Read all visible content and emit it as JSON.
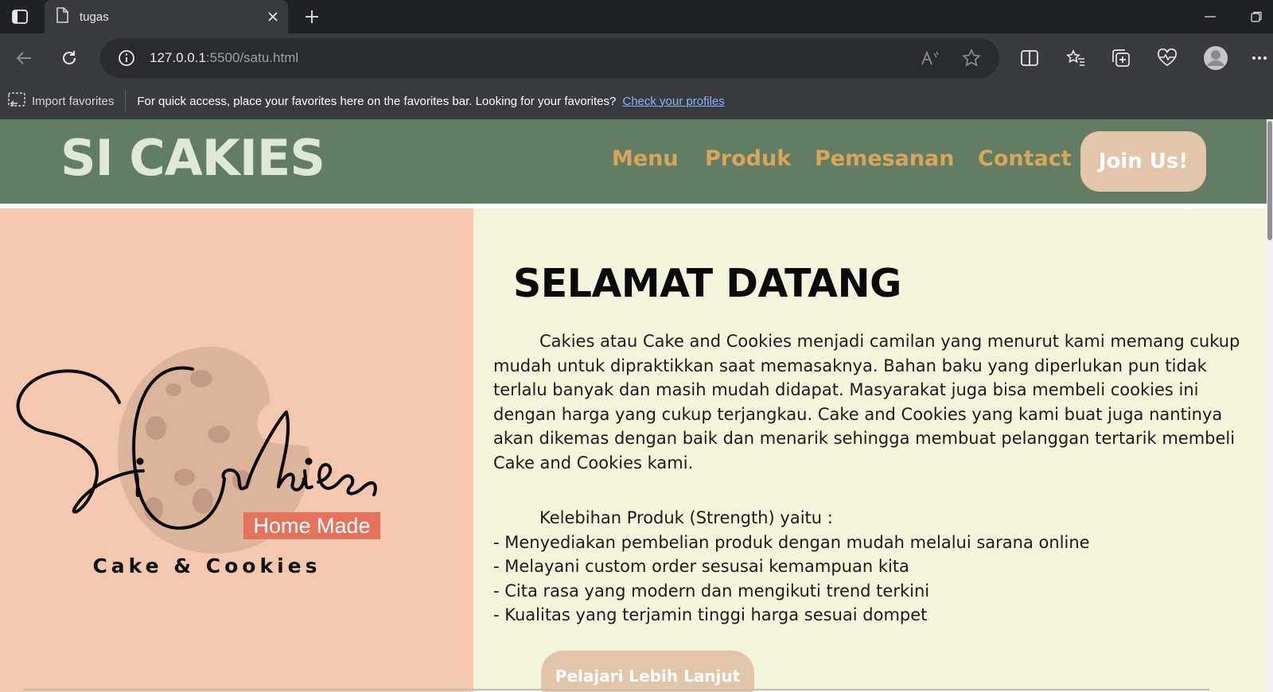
{
  "browser": {
    "tab_title": "tugas",
    "url_host": "127.0.0.1",
    "url_path": ":5500/satu.html",
    "favorites_bar": {
      "import_label": "Import favorites",
      "message": "For quick access, place your favorites here on the favorites bar. Looking for your favorites?",
      "link_label": "Check your profiles"
    }
  },
  "site": {
    "brand": "SI CAKIES",
    "nav": [
      "Menu",
      "Produk",
      "Pemesanan",
      "Contact"
    ],
    "join_label": "Join Us!",
    "logo": {
      "script_text": "Si Cakies",
      "badge": "Home Made",
      "tagline": "Cake & Cookies"
    },
    "welcome_title": "SELAMAT DATANG",
    "intro": "Cakies atau Cake and Cookies menjadi camilan yang menurut kami memang cukup mudah untuk dipraktikkan saat memasaknya. Bahan baku yang diperlukan pun tidak terlalu banyak dan masih mudah didapat. Masyarakat juga bisa membeli cookies ini dengan harga yang cukup terjangkau. Cake and Cookies yang kami buat juga nantinya akan dikemas dengan baik dan menarik sehingga membuat pelanggan tertarik membeli Cake and Cookies kami.",
    "strength_heading": "Kelebihan Produk (Strength) yaitu :",
    "strengths": [
      "- Menyediakan pembelian produk dengan mudah melalui sarana online",
      "- Melayani custom order sesusai kemampuan kita",
      "- Cita rasa yang modern dan mengikuti trend terkini",
      "- Kualitas yang terjamin tinggi harga sesuai dompet"
    ],
    "cta_label": "Pelajari Lebih Lanjut"
  },
  "colors": {
    "header_bg": "#637d65",
    "brand_text": "#dfe8d7",
    "nav_text": "#d8a55a",
    "button_bg": "#e3c5aa",
    "hero_left_bg": "#f4c8ae",
    "hero_right_bg": "#f4f3dc"
  }
}
